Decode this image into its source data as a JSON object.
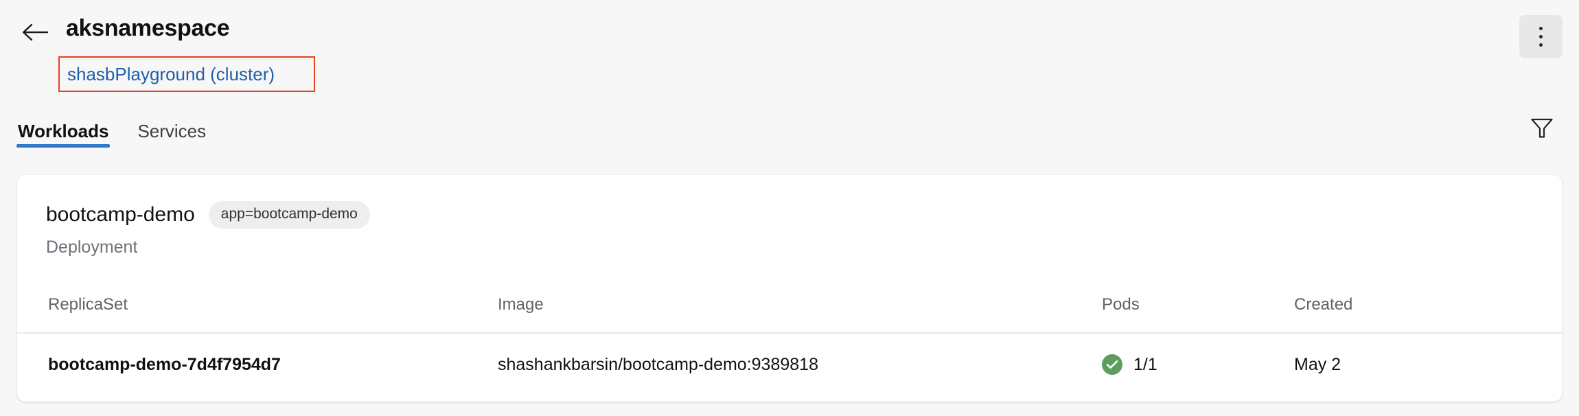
{
  "header": {
    "back_icon": "arrow-left-icon",
    "title": "aksnamespace",
    "cluster_link": "shasbPlayground (cluster)",
    "overflow_icon": "kebab-menu-icon",
    "highlight_color": "#e8411f",
    "link_color": "#1f5fa8"
  },
  "tabs": {
    "items": [
      {
        "label": "Workloads",
        "active": true
      },
      {
        "label": "Services",
        "active": false
      }
    ],
    "active_indicator_color": "#3079c8",
    "filter_icon": "filter-funnel-icon"
  },
  "workload": {
    "name": "bootcamp-demo",
    "label_chip": "app=bootcamp-demo",
    "kind": "Deployment"
  },
  "table": {
    "columns": [
      "ReplicaSet",
      "Image",
      "Pods",
      "Created"
    ],
    "rows": [
      {
        "replicaset": "bootcamp-demo-7d4f7954d7",
        "image": "shashankbarsin/bootcamp-demo:9389818",
        "pods": "1/1",
        "pods_status_icon": "check-circle-icon",
        "pods_status_color": "#5c9e5e",
        "created": "May 2"
      }
    ]
  }
}
